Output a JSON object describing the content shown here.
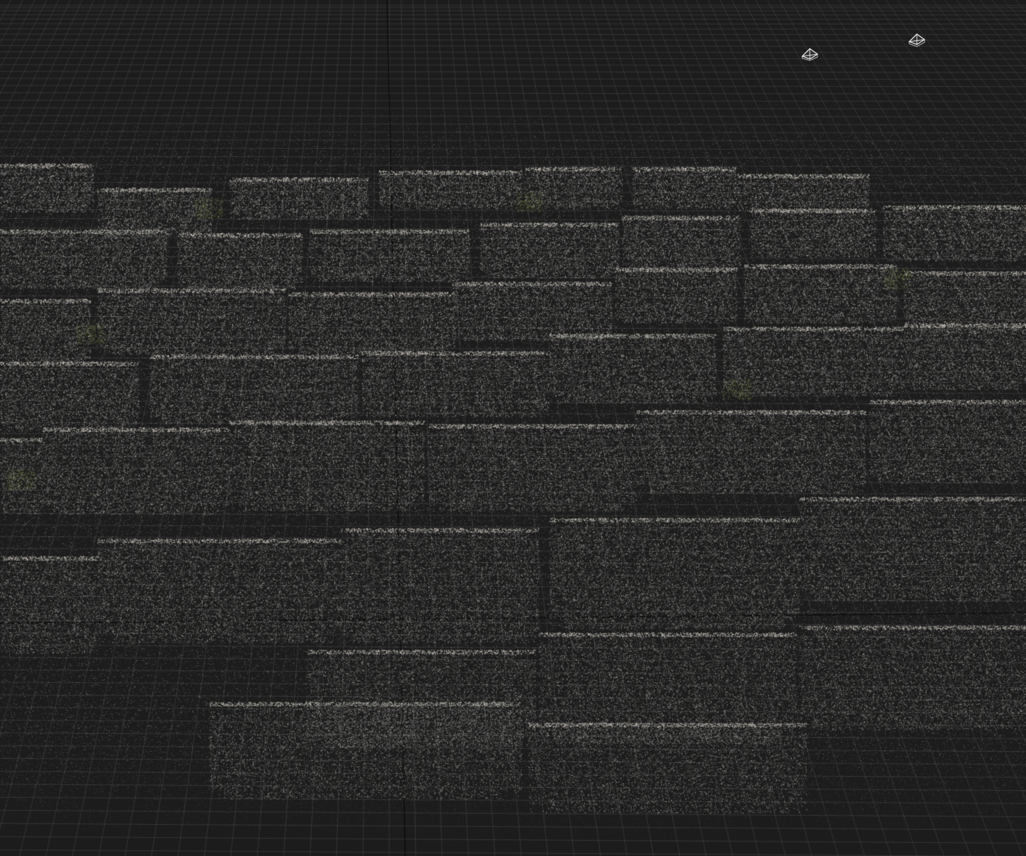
{
  "viewport": {
    "type": "3d-point-cloud-viewer",
    "background": "#1c1c1c",
    "grid_color": "#4a4a4a",
    "grid_axis_color": "#0a0a0a",
    "point_colors": [
      "#8d8f96",
      "#a7a49c",
      "#7a7b80",
      "#b8b4aa",
      "#6f7466",
      "#9a9385",
      "#c9c6c0"
    ]
  },
  "cameras": [
    {
      "name": "camera-frustum-1",
      "icon": "camera-frustum-icon",
      "color": "#e6e6e6"
    },
    {
      "name": "camera-frustum-2",
      "icon": "camera-frustum-icon",
      "color": "#e6e6e6"
    }
  ]
}
